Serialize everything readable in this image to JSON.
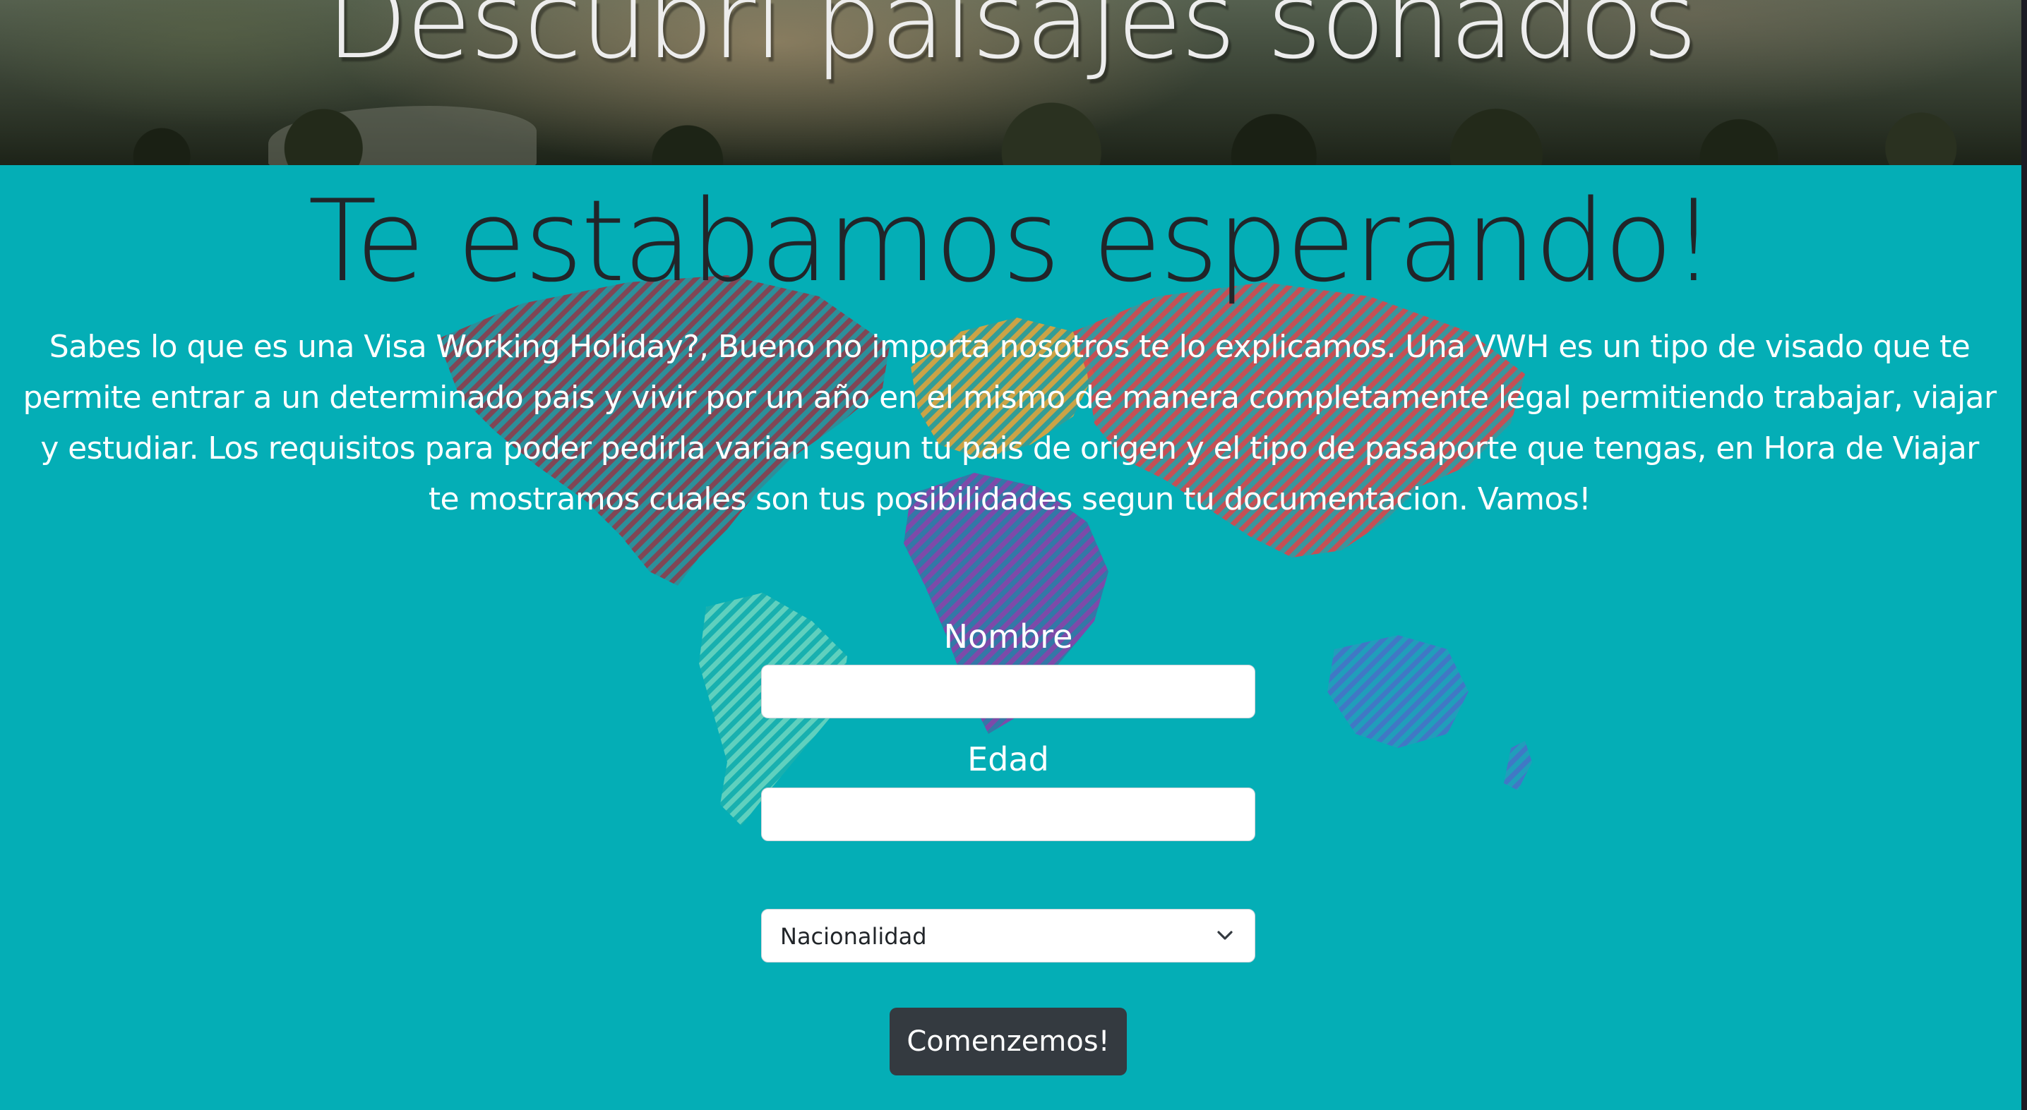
{
  "hero": {
    "title": "Descubrí paisajes soñados"
  },
  "main": {
    "title": "Te estabamos esperando!",
    "intro": "Sabes lo que es una Visa Working Holiday?, Bueno no importa nosotros te lo explicamos. Una VWH es un tipo de visado que te permite entrar a un determinado pais y vivir por un año en el mismo de manera completamente legal permitiendo trabajar, viajar y estudiar. Los requisitos para poder pedirla varian segun tu pais de origen y el tipo de pasaporte que tengas, en Hora de Viajar te mostramos cuales son tus posibilidades segun tu documentacion. Vamos!"
  },
  "form": {
    "name_label": "Nombre",
    "name_value": "",
    "age_label": "Edad",
    "age_value": "",
    "nationality_selected": "Nacionalidad",
    "submit_label": "Comenzemos!"
  },
  "colors": {
    "page_background": "#04aeb6",
    "title_text": "#212529",
    "button_background": "#343a40",
    "map_north_america": "#8e3a4a",
    "map_south_america": "#3fc2a4",
    "map_europe": "#e0a23a",
    "map_africa": "#8a3fa8",
    "map_asia": "#d9464a",
    "map_oceania": "#4a6fc8"
  },
  "icons": {
    "select_caret": "chevron-down-icon"
  }
}
